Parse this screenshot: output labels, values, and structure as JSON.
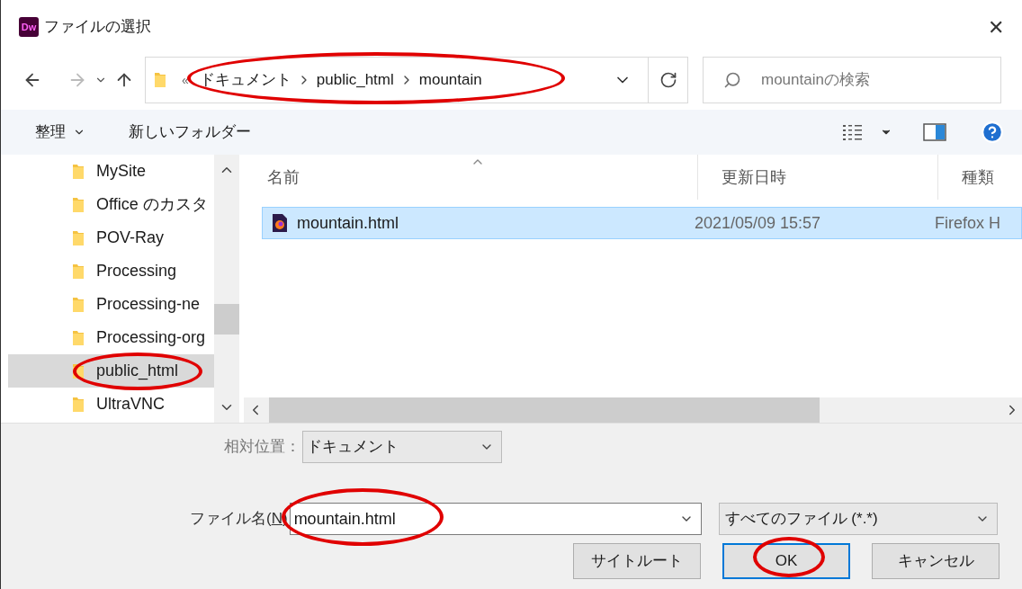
{
  "window": {
    "app_badge": "Dw",
    "title": "ファイルの選択",
    "close": "✕"
  },
  "address": {
    "overflow": "«",
    "crumbs": [
      "ドキュメント",
      "public_html",
      "mountain"
    ]
  },
  "search": {
    "placeholder": "mountainの検索"
  },
  "toolbar": {
    "organize": "整理",
    "new_folder": "新しいフォルダー"
  },
  "tree": {
    "items": [
      {
        "label": "MySite",
        "selected": false
      },
      {
        "label": "Office のカスタ",
        "selected": false
      },
      {
        "label": "POV-Ray",
        "selected": false
      },
      {
        "label": "Processing",
        "selected": false
      },
      {
        "label": "Processing-ne",
        "selected": false
      },
      {
        "label": "Processing-org",
        "selected": false
      },
      {
        "label": "public_html",
        "selected": true
      },
      {
        "label": "UltraVNC",
        "selected": false
      }
    ]
  },
  "file_list": {
    "columns": [
      "名前",
      "更新日時",
      "種類"
    ],
    "rows": [
      {
        "name": "mountain.html",
        "modified": "2021/05/09 15:57",
        "type": "Firefox H",
        "selected": true
      }
    ]
  },
  "relative": {
    "label": "相対位置：",
    "value": "ドキュメント"
  },
  "filename": {
    "label": "ファイル名(N)",
    "value": "mountain.html"
  },
  "filter": {
    "value": "すべてのファイル (*.*)"
  },
  "buttons": [
    {
      "label": "サイトルート",
      "kind": "normal"
    },
    {
      "label": "OK",
      "kind": "default"
    },
    {
      "label": "キャンセル",
      "kind": "normal"
    }
  ]
}
